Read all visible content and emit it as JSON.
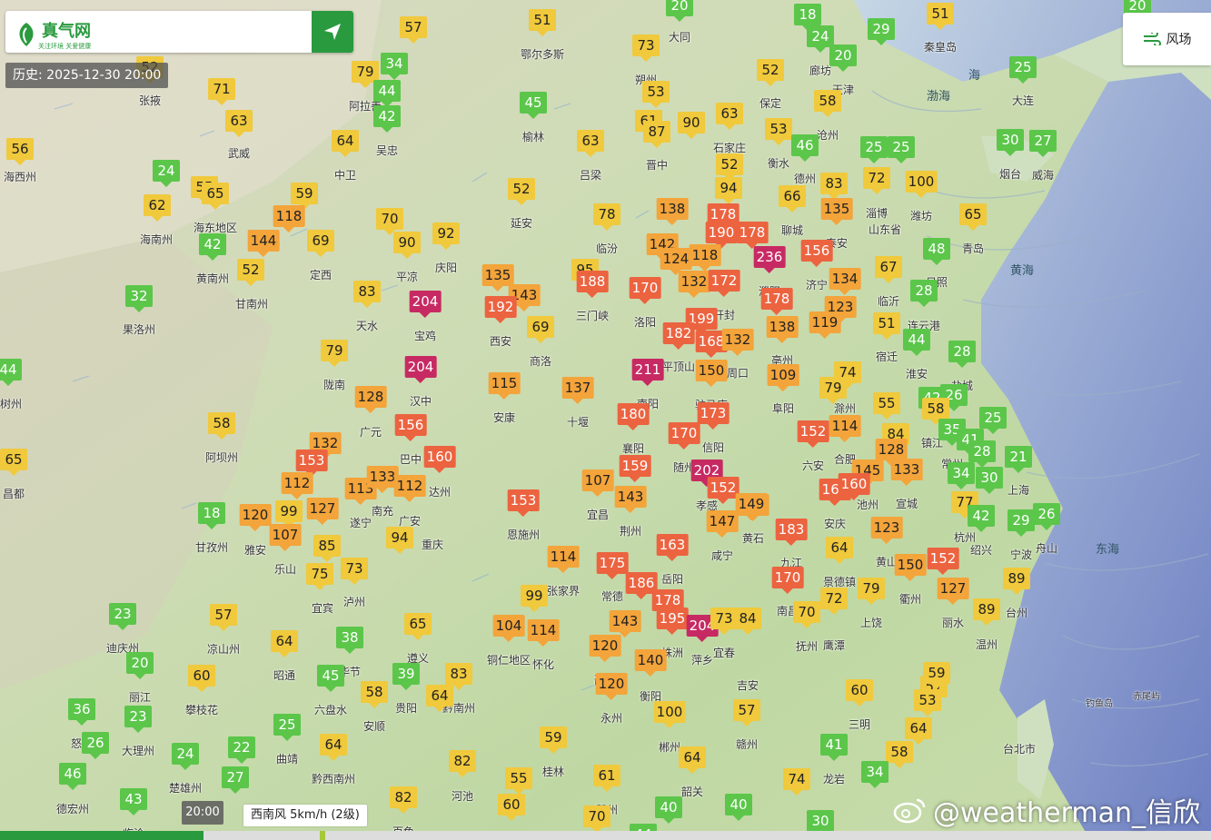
{
  "app": {
    "name": "真气网",
    "slogan": "关注环境 关爱健康",
    "history_label": "历史: 2025-12-30 20:00",
    "wind_toggle_label": "风场",
    "timeline_time": "20:00",
    "wind_readout": "西南风 5km/h (2级)",
    "watermark": "@weatherman_信欣",
    "timeline_progress": 0.168
  },
  "colors": {
    "brand": "#2a9a3f",
    "aqi_good": "#5bc64a",
    "aqi_moderate": "#f0c93c",
    "aqi_light": "#f3a43a",
    "aqi_medium": "#ec6340",
    "aqi_heavy": "#c72a62"
  },
  "seas": [
    "渤海",
    "黄海",
    "东海",
    "海"
  ],
  "map_labels": [
    "台北市",
    "钓鱼岛",
    "赤尾屿"
  ],
  "stations": [
    {
      "v": 57
    },
    {
      "v": 51
    },
    {
      "v": 20
    },
    {
      "v": 18
    },
    {
      "v": 24
    },
    {
      "v": 29
    },
    {
      "v": 51
    },
    {
      "v": 20
    },
    {
      "v": 52
    },
    {
      "v": 34
    },
    {
      "v": 79
    },
    {
      "v": 73
    },
    {
      "v": 44
    },
    {
      "v": 20
    },
    {
      "v": 52
    },
    {
      "v": 25
    },
    {
      "v": 71
    },
    {
      "v": 42
    },
    {
      "v": 45
    },
    {
      "v": 53
    },
    {
      "v": 58
    },
    {
      "v": 63
    },
    {
      "v": 64
    },
    {
      "v": 61
    },
    {
      "v": 90
    },
    {
      "v": 87
    },
    {
      "v": 63
    },
    {
      "v": 53
    },
    {
      "v": 56
    },
    {
      "v": 63
    },
    {
      "v": 46
    },
    {
      "v": 25
    },
    {
      "v": 25
    },
    {
      "v": 30
    },
    {
      "v": 27
    },
    {
      "v": 24
    },
    {
      "v": 52
    },
    {
      "v": 52
    },
    {
      "v": 72
    },
    {
      "v": 55
    },
    {
      "v": 65
    },
    {
      "v": 59
    },
    {
      "v": 62
    },
    {
      "v": 94
    },
    {
      "v": 83
    },
    {
      "v": 100
    },
    {
      "v": 66
    },
    {
      "v": 118
    },
    {
      "v": 70
    },
    {
      "v": 138
    },
    {
      "v": 178
    },
    {
      "v": 135
    },
    {
      "v": 92
    },
    {
      "v": 78
    },
    {
      "v": 65
    },
    {
      "v": 144
    },
    {
      "v": 69
    },
    {
      "v": 90
    },
    {
      "v": 190
    },
    {
      "v": 178
    },
    {
      "v": 42
    },
    {
      "v": 142
    },
    {
      "v": 156
    },
    {
      "v": 48
    },
    {
      "v": 52
    },
    {
      "v": 124
    },
    {
      "v": 118
    },
    {
      "v": 236
    },
    {
      "v": 135
    },
    {
      "v": 95
    },
    {
      "v": 67
    },
    {
      "v": 32
    },
    {
      "v": 83
    },
    {
      "v": 204
    },
    {
      "v": 188
    },
    {
      "v": 143
    },
    {
      "v": 170
    },
    {
      "v": 132
    },
    {
      "v": 172
    },
    {
      "v": 134
    },
    {
      "v": 28
    },
    {
      "v": 192
    },
    {
      "v": 178
    },
    {
      "v": 123
    },
    {
      "v": 69
    },
    {
      "v": 199
    },
    {
      "v": 138
    },
    {
      "v": 119
    },
    {
      "v": 51
    },
    {
      "v": 79
    },
    {
      "v": 182
    },
    {
      "v": 168
    },
    {
      "v": 132
    },
    {
      "v": 109
    },
    {
      "v": 44
    },
    {
      "v": 44
    },
    {
      "v": 204
    },
    {
      "v": 211
    },
    {
      "v": 150
    },
    {
      "v": 109
    },
    {
      "v": 74
    },
    {
      "v": 28
    },
    {
      "v": 115
    },
    {
      "v": 137
    },
    {
      "v": 79
    },
    {
      "v": 55
    },
    {
      "v": 42
    },
    {
      "v": 26
    },
    {
      "v": 128
    },
    {
      "v": 180
    },
    {
      "v": 173
    },
    {
      "v": 58
    },
    {
      "v": 58
    },
    {
      "v": 156
    },
    {
      "v": 170
    },
    {
      "v": 152
    },
    {
      "v": 114
    },
    {
      "v": 84
    },
    {
      "v": 25
    },
    {
      "v": 35
    },
    {
      "v": 41
    },
    {
      "v": 65
    },
    {
      "v": 132
    },
    {
      "v": 160
    },
    {
      "v": 128
    },
    {
      "v": 28
    },
    {
      "v": 21
    },
    {
      "v": 153
    },
    {
      "v": 159
    },
    {
      "v": 202
    },
    {
      "v": 145
    },
    {
      "v": 133
    },
    {
      "v": 112
    },
    {
      "v": 113
    },
    {
      "v": 133
    },
    {
      "v": 112
    },
    {
      "v": 107
    },
    {
      "v": 143
    },
    {
      "v": 152
    },
    {
      "v": 149
    },
    {
      "v": 169
    },
    {
      "v": 160
    },
    {
      "v": 34
    },
    {
      "v": 30
    },
    {
      "v": 153
    },
    {
      "v": 18
    },
    {
      "v": 120
    },
    {
      "v": 99
    },
    {
      "v": 127
    },
    {
      "v": 77
    },
    {
      "v": 42
    },
    {
      "v": 26
    },
    {
      "v": 107
    },
    {
      "v": 94
    },
    {
      "v": 147
    },
    {
      "v": 149
    },
    {
      "v": 183
    },
    {
      "v": 123
    },
    {
      "v": 29
    },
    {
      "v": 85
    },
    {
      "v": 114
    },
    {
      "v": 163
    },
    {
      "v": 64
    },
    {
      "v": 150
    },
    {
      "v": 152
    },
    {
      "v": 75
    },
    {
      "v": 73
    },
    {
      "v": 175
    },
    {
      "v": 186
    },
    {
      "v": 170
    },
    {
      "v": 79
    },
    {
      "v": 89
    },
    {
      "v": 99
    },
    {
      "v": 178
    },
    {
      "v": 72
    },
    {
      "v": 127
    },
    {
      "v": 23
    },
    {
      "v": 57
    },
    {
      "v": 65
    },
    {
      "v": 104
    },
    {
      "v": 114
    },
    {
      "v": 143
    },
    {
      "v": 195
    },
    {
      "v": 204
    },
    {
      "v": 73
    },
    {
      "v": 84
    },
    {
      "v": 70
    },
    {
      "v": 89
    },
    {
      "v": 64
    },
    {
      "v": 38
    },
    {
      "v": 120
    },
    {
      "v": 140
    },
    {
      "v": 60
    },
    {
      "v": 20
    },
    {
      "v": 60
    },
    {
      "v": 45
    },
    {
      "v": 39
    },
    {
      "v": 83
    },
    {
      "v": 120
    },
    {
      "v": 57
    },
    {
      "v": 60
    },
    {
      "v": 59
    },
    {
      "v": 36
    },
    {
      "v": 23
    },
    {
      "v": 58
    },
    {
      "v": 64
    },
    {
      "v": 100
    },
    {
      "v": 57
    },
    {
      "v": 53
    },
    {
      "v": 25
    },
    {
      "v": 26
    },
    {
      "v": 24
    },
    {
      "v": 22
    },
    {
      "v": 64
    },
    {
      "v": 59
    },
    {
      "v": 64
    },
    {
      "v": 46
    },
    {
      "v": 27
    },
    {
      "v": 82
    },
    {
      "v": 55
    },
    {
      "v": 61
    },
    {
      "v": 64
    },
    {
      "v": 41
    },
    {
      "v": 58
    },
    {
      "v": 43
    },
    {
      "v": 82
    },
    {
      "v": 60
    },
    {
      "v": 40
    },
    {
      "v": 40
    },
    {
      "v": 74
    },
    {
      "v": 34
    },
    {
      "v": 70
    },
    {
      "v": 30
    },
    {
      "v": 44
    },
    {
      "v": 65
    },
    {
      "v": 56
    }
  ],
  "cities": [
    "海西州",
    "张掖",
    "武威",
    "海东地区",
    "海南州",
    "黄南州",
    "甘南州",
    "果洛州",
    "树州",
    "阿拉善",
    "中卫",
    "吴忠",
    "定西",
    "平凉",
    "庆阳",
    "天水",
    "陇南",
    "阿坝州",
    "昌都",
    "甘孜州",
    "雅安",
    "乐山",
    "宜宾",
    "泸州",
    "凉山州",
    "迪庆州",
    "丽江",
    "攀枝花",
    "怒江",
    "大理州",
    "楚雄州",
    "德宏州",
    "临沧",
    "鄂尔多斯",
    "榆林",
    "吕梁",
    "延安",
    "临汾",
    "三门峡",
    "洛阳",
    "宝鸡",
    "西安",
    "商洛",
    "汉中",
    "安康",
    "十堰",
    "巴中",
    "达州",
    "广元",
    "遂宁",
    "南充",
    "广安",
    "重庆",
    "恩施州",
    "宜昌",
    "荆州",
    "襄阳",
    "随州",
    "孝感",
    "咸宁",
    "岳阳",
    "常德",
    "张家界",
    "怀化",
    "铜仁地区",
    "遵义",
    "毕节",
    "昭通",
    "六盘水",
    "安顺",
    "贵阳",
    "黔南州",
    "黔西南州",
    "曲靖",
    "河池",
    "百色",
    "大同",
    "朔州",
    "阳泉",
    "晋中",
    "石家庄",
    "保定",
    "衡水",
    "德州",
    "沧州",
    "天津",
    "廊坊",
    "秦皇岛",
    "大连",
    "烟台",
    "威海",
    "青岛",
    "日照",
    "连云港",
    "盐城",
    "淮安",
    "宿迁",
    "临沂",
    "济宁",
    "泰安",
    "聊城",
    "淄博",
    "潍坊",
    "山东省",
    "濮阳",
    "开封",
    "平顶山",
    "周口",
    "驻马店",
    "南阳",
    "信阳",
    "亳州",
    "阜阳",
    "六安",
    "合肥",
    "安庆",
    "池州",
    "黄石",
    "九江",
    "景德镇",
    "上饶",
    "衢州",
    "丽水",
    "温州",
    "台州",
    "宁波",
    "舟山",
    "绍兴",
    "杭州",
    "上海",
    "宣城",
    "黄山",
    "南昌",
    "萍乡",
    "宜春",
    "吉安",
    "抚州",
    "鹰潭",
    "三明",
    "赣州",
    "龙岩",
    "韶关",
    "郴州",
    "永州",
    "衡阳",
    "邵阳",
    "株洲",
    "贺州",
    "桂林",
    "镇江",
    "常州",
    "滁州"
  ]
}
